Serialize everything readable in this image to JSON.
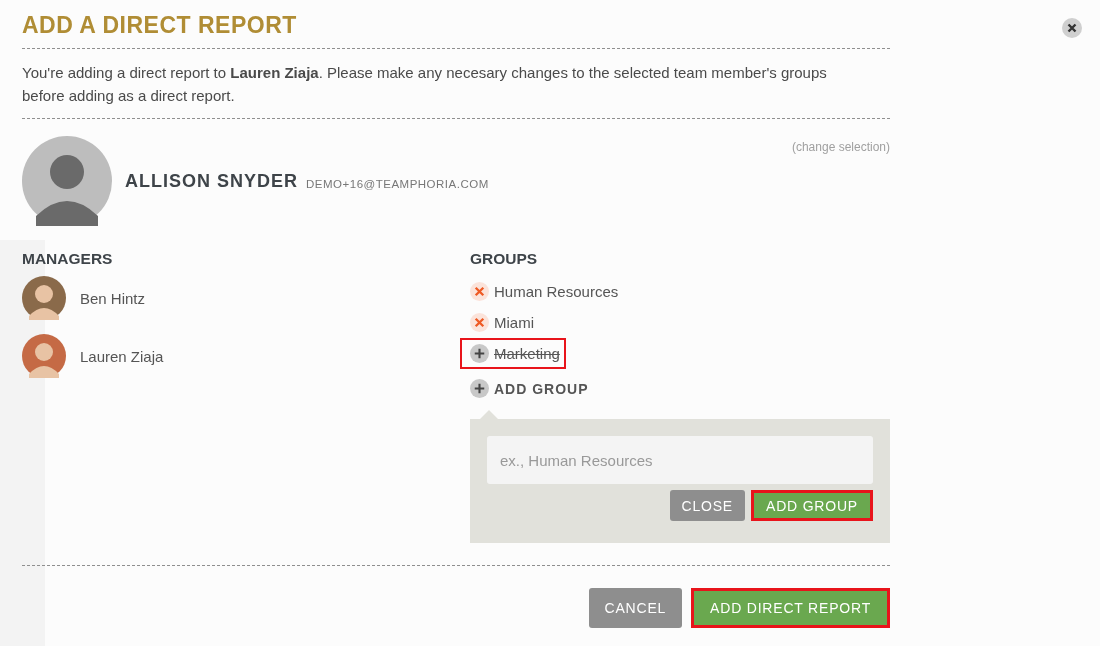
{
  "dialog": {
    "title": "ADD A DIRECT REPORT",
    "intro": "You're adding a direct report to **Lauren Ziaja**. Please make any necesary changes to the selected team member's groups before adding as a direct report.",
    "change_link": "(change selection)"
  },
  "member": {
    "name": "ALLISON SNYDER",
    "email": "DEMO+16@TEAMPHORIA.COM"
  },
  "managers": {
    "heading": "MANAGERS",
    "items": [
      {
        "name": "Ben Hintz"
      },
      {
        "name": "Lauren Ziaja"
      }
    ]
  },
  "groups": {
    "heading": "GROUPS",
    "items": [
      {
        "name": "Human Resources",
        "removed": false,
        "highlighted": false
      },
      {
        "name": "Miami",
        "removed": false,
        "highlighted": false
      },
      {
        "name": "Marketing",
        "removed": true,
        "highlighted": true
      }
    ],
    "add_label": "ADD GROUP"
  },
  "add_group_panel": {
    "placeholder": "ex., Human Resources",
    "buttons": [
      {
        "label": "CLOSE",
        "kind": "secondary",
        "highlighted": false
      },
      {
        "label": "ADD GROUP",
        "kind": "primary",
        "highlighted": true
      }
    ]
  },
  "footer_buttons": [
    {
      "label": "CANCEL",
      "kind": "secondary",
      "highlighted": false
    },
    {
      "label": "ADD DIRECT REPORT",
      "kind": "primary",
      "highlighted": true
    }
  ]
}
